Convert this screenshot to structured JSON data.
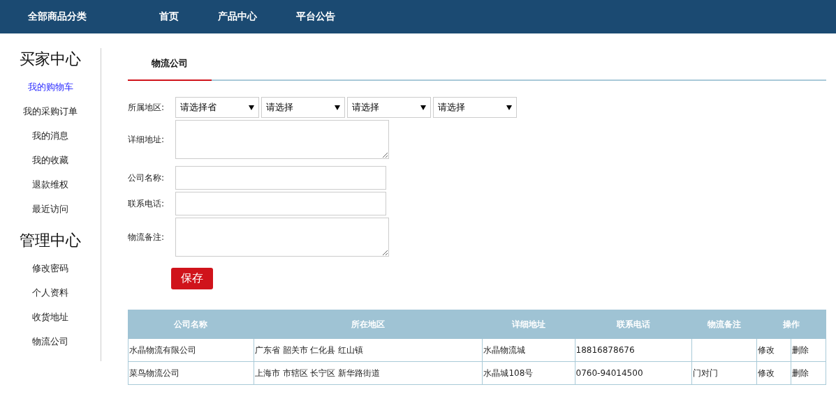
{
  "top_nav": {
    "category": "全部商品分类",
    "links": [
      {
        "label": "首页"
      },
      {
        "label": "产品中心"
      },
      {
        "label": "平台公告"
      }
    ]
  },
  "sidebar": {
    "sections": [
      {
        "title": "买家中心",
        "items": [
          {
            "label": "我的购物车",
            "selected": true
          },
          {
            "label": "我的采购订单",
            "selected": false
          },
          {
            "label": "我的消息",
            "selected": false
          },
          {
            "label": "我的收藏",
            "selected": false
          },
          {
            "label": "退款维权",
            "selected": false
          },
          {
            "label": "最近访问",
            "selected": false
          }
        ]
      },
      {
        "title": "管理中心",
        "items": [
          {
            "label": "修改密码",
            "selected": false
          },
          {
            "label": "个人资料",
            "selected": false
          },
          {
            "label": "收货地址",
            "selected": false
          },
          {
            "label": "物流公司",
            "selected": false
          }
        ]
      }
    ]
  },
  "tabs": [
    {
      "label": "物流公司",
      "selected": true
    }
  ],
  "form": {
    "fields": [
      {
        "label": "所属地区:",
        "kind": "selects",
        "selects": [
          "请选择省",
          "请选择",
          "请选择",
          "请选择"
        ]
      },
      {
        "label": "详细地址:",
        "kind": "textarea"
      },
      {
        "label": "公司名称:",
        "kind": "input"
      },
      {
        "label": "联系电话:",
        "kind": "input"
      },
      {
        "label": "物流备注:",
        "kind": "textarea"
      }
    ],
    "submit": "保存"
  },
  "table": {
    "columns": [
      "公司名称",
      "所在地区",
      "详细地址",
      "联系电话",
      "物流备注",
      "操作"
    ],
    "rows": [
      {
        "cells": [
          "水晶物流有限公司",
          "广东省 韶关市 仁化县 红山镇",
          "水晶物流城",
          "18816878676",
          ""
        ],
        "actions": [
          "修改",
          "删除"
        ]
      },
      {
        "cells": [
          "菜鸟物流公司",
          "上海市 市辖区 长宁区 新华路街道",
          "水晶城108号",
          "0760-94014500",
          "门对门"
        ],
        "actions": [
          "修改",
          "删除"
        ]
      }
    ]
  }
}
